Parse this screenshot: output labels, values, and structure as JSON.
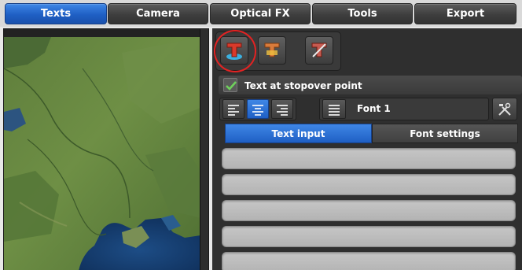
{
  "tabs": [
    {
      "label": "Texts",
      "active": true
    },
    {
      "label": "Camera",
      "active": false
    },
    {
      "label": "Optical FX",
      "active": false
    },
    {
      "label": "Tools",
      "active": false
    },
    {
      "label": "Export",
      "active": false
    }
  ],
  "toolbar": {
    "icons": [
      "text-insert-icon",
      "text-edit-icon",
      "text-delete-icon"
    ]
  },
  "stopover": {
    "checked": true,
    "label": "Text at stopover point"
  },
  "alignment": {
    "options": [
      "align-left-icon",
      "align-center-icon",
      "align-right-icon"
    ],
    "selected": "center"
  },
  "font": {
    "name": "Font 1"
  },
  "subtabs": [
    {
      "label": "Text input",
      "active": true
    },
    {
      "label": "Font settings",
      "active": false
    }
  ],
  "text_lines": [
    "",
    "",
    "",
    "",
    ""
  ],
  "colors": {
    "accent": "#1f5fc4",
    "highlight_ring": "#e32222",
    "panel": "#2f2f2f"
  }
}
